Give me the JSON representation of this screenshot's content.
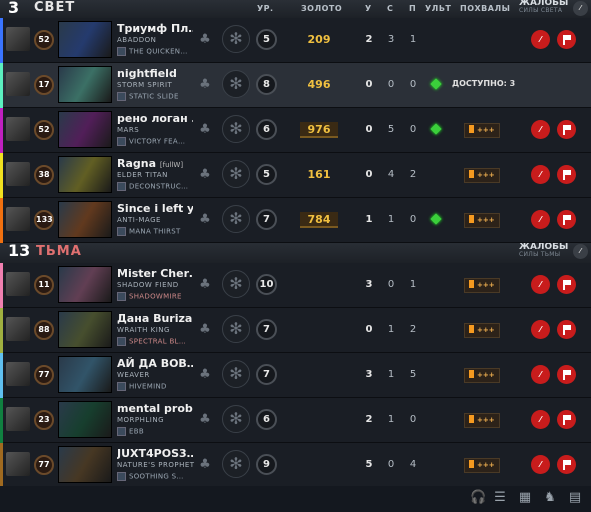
{
  "radiant": {
    "score": "3",
    "name": "СВЕТ",
    "report_title": "ЖАЛОБЫ",
    "report_sub": "СИЛЫ СВЕТА",
    "mute_label": "⁄"
  },
  "dire": {
    "score": "13",
    "name": "ТЬМА",
    "report_title": "ЖАЛОБЫ",
    "report_sub": "СИЛЫ ТЬМЫ"
  },
  "columns": {
    "level": "УР.",
    "gold": "ЗОЛОТО",
    "kills": "У",
    "deaths": "С",
    "assists": "П",
    "ult": "УЛЬТ",
    "commends": "ПОХВАЛЫ"
  },
  "commend_label": "+++",
  "report_label": "⁄",
  "colors": {
    "gold": "#f0c040",
    "ult_ready": "#3bcf3b",
    "report_red": "#c81c1c"
  },
  "players": [
    {
      "slot_color": "#3a74ff",
      "account_level": "52",
      "name": "Триумф Пл…",
      "tag": "",
      "hero": "ABADDON",
      "item": "THE QUICKEN…",
      "level": "5",
      "gold": "209",
      "gold_box": false,
      "k": "2",
      "d": "3",
      "a": "1",
      "ult": false,
      "commend": false,
      "avail": "",
      "reports": true,
      "self": false
    },
    {
      "slot_color": "#5cf0c0",
      "account_level": "17",
      "name": "nightfield",
      "tag": "",
      "hero": "STORM SPIRIT",
      "item": "STATIC SLIDE",
      "level": "8",
      "gold": "496",
      "gold_box": false,
      "k": "0",
      "d": "0",
      "a": "0",
      "ult": true,
      "commend": false,
      "avail": "ДОСТУПНО: 3",
      "reports": false,
      "self": true
    },
    {
      "slot_color": "#c020c0",
      "account_level": "52",
      "name": "рено логан …",
      "tag": "",
      "hero": "MARS",
      "item": "VICTORY FEA…",
      "level": "6",
      "gold": "976",
      "gold_box": true,
      "k": "0",
      "d": "5",
      "a": "0",
      "ult": true,
      "commend": true,
      "avail": "",
      "reports": true,
      "self": false
    },
    {
      "slot_color": "#f0e020",
      "account_level": "38",
      "name": "Ragna",
      "tag": "[fullW]",
      "hero": "ELDER TITAN",
      "item": "DECONSTRUC…",
      "level": "5",
      "gold": "161",
      "gold_box": false,
      "k": "0",
      "d": "4",
      "a": "2",
      "ult": false,
      "commend": true,
      "avail": "",
      "reports": true,
      "self": false
    },
    {
      "slot_color": "#f07010",
      "account_level": "133",
      "name": "Since i left y…",
      "tag": "",
      "hero": "ANTI-MAGE",
      "item": "MANA THIRST",
      "level": "7",
      "gold": "784",
      "gold_box": true,
      "k": "1",
      "d": "1",
      "a": "0",
      "ult": true,
      "commend": true,
      "avail": "",
      "reports": true,
      "self": false
    },
    {
      "slot_color": "#f080b0",
      "account_level": "11",
      "name": "Mister Cher…",
      "tag": "",
      "hero": "SHADOW FIEND",
      "item": "SHADOWMIRE",
      "level": "10",
      "gold": "",
      "gold_box": false,
      "k": "3",
      "d": "0",
      "a": "1",
      "ult": false,
      "commend": true,
      "avail": "",
      "reports": true,
      "self": false
    },
    {
      "slot_color": "#a0b040",
      "account_level": "88",
      "name": "Дана Buriza…",
      "tag": "",
      "hero": "WRAITH KING",
      "item": "SPECTRAL BL…",
      "level": "7",
      "gold": "",
      "gold_box": false,
      "k": "0",
      "d": "1",
      "a": "2",
      "ult": false,
      "commend": true,
      "avail": "",
      "reports": true,
      "self": false
    },
    {
      "slot_color": "#60c0f0",
      "account_level": "77",
      "name": "АЙ ДА ВОВ…",
      "tag": "",
      "hero": "WEAVER",
      "item": "HIVEMIND",
      "level": "7",
      "gold": "",
      "gold_box": false,
      "k": "3",
      "d": "1",
      "a": "5",
      "ult": false,
      "commend": true,
      "avail": "",
      "reports": true,
      "self": false
    },
    {
      "slot_color": "#108040",
      "account_level": "23",
      "name": "mental prob…",
      "tag": "",
      "hero": "MORPHLING",
      "item": "EBB",
      "level": "6",
      "gold": "",
      "gold_box": false,
      "k": "2",
      "d": "1",
      "a": "0",
      "ult": false,
      "commend": true,
      "avail": "",
      "reports": true,
      "self": false
    },
    {
      "slot_color": "#a06a20",
      "account_level": "77",
      "name": "JUXT4POS3…",
      "tag": "",
      "hero": "NATURE'S PROPHET",
      "item": "SOOTHING S…",
      "level": "9",
      "gold": "",
      "gold_box": false,
      "k": "5",
      "d": "0",
      "a": "4",
      "ult": false,
      "commend": true,
      "avail": "",
      "reports": true,
      "self": false
    }
  ]
}
